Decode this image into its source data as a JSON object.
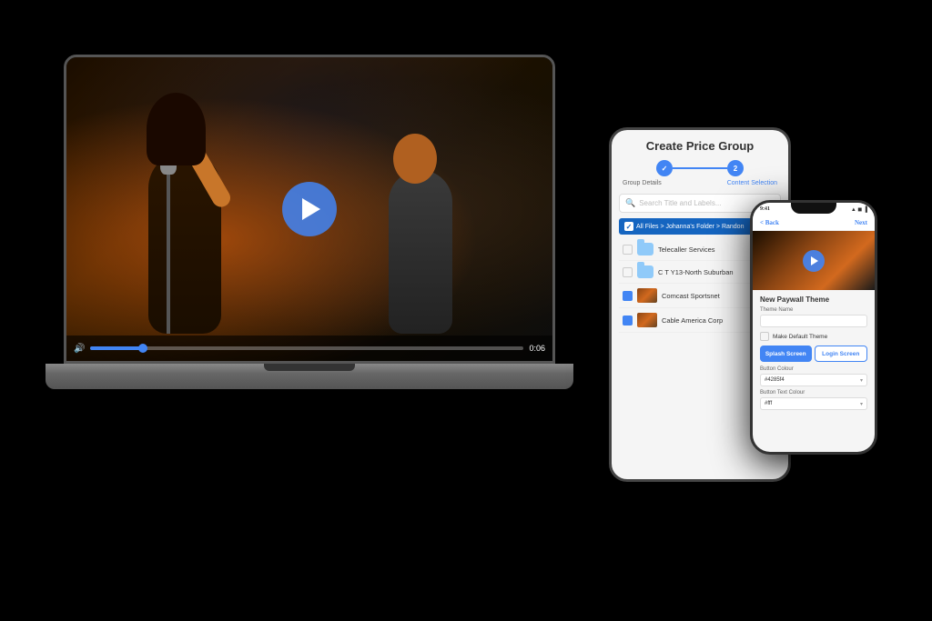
{
  "scene": {
    "background": "#000000"
  },
  "laptop": {
    "video": {
      "play_button_label": "Play",
      "time_current": "0:06",
      "time_total": "0:06",
      "progress_percent": 12
    }
  },
  "tablet": {
    "title": "Create Price Group",
    "stepper": {
      "step1_label": "Group Details",
      "step2_label": "Content Selection",
      "step1_active": true,
      "step2_active": true
    },
    "search": {
      "placeholder": "Search Title and Labels..."
    },
    "breadcrumb": {
      "text": "All Files > Johanna's Folder > Randon"
    },
    "files": [
      {
        "name": "Telecaller Services",
        "type": "folder",
        "checked": false
      },
      {
        "name": "C T Y13-North Suburban",
        "type": "folder",
        "checked": false
      },
      {
        "name": "Comcast Sportsnet",
        "type": "video",
        "checked": true
      },
      {
        "name": "Cable America Corp",
        "type": "video",
        "checked": true
      }
    ]
  },
  "phone": {
    "status_bar": {
      "time": "9:41",
      "icons": "▲ ◼ ▐"
    },
    "header": {
      "back_label": "< Back",
      "next_label": "Next"
    },
    "section_title": "New Paywall Theme",
    "form": {
      "theme_name_label": "Theme Name",
      "theme_name_value": "",
      "make_default_label": "Make Default Theme",
      "splash_screen_label": "Splash Screen",
      "login_screen_label": "Login Screen",
      "button_colour_label": "Button Colour",
      "button_colour_value": "#4285f4",
      "button_text_colour_label": "Button Text Colour",
      "button_text_colour_value": "#fff"
    }
  }
}
